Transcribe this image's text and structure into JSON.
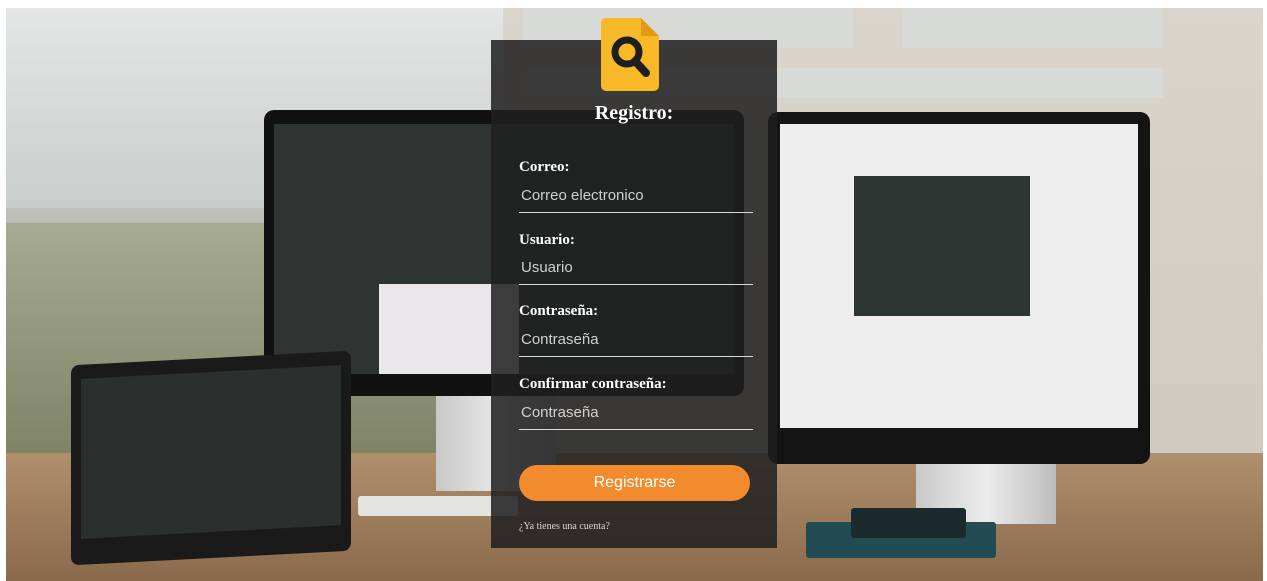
{
  "brand": {
    "logo_icon": "search-document-icon",
    "accent": "#f7b928"
  },
  "form": {
    "title": "Registro:",
    "fields": [
      {
        "label": "Correo:",
        "placeholder": "Correo electronico"
      },
      {
        "label": "Usuario:",
        "placeholder": "Usuario"
      },
      {
        "label": "Contraseña:",
        "placeholder": "Contraseña"
      },
      {
        "label": "Confirmar contraseña:",
        "placeholder": "Contraseña"
      }
    ],
    "submit_label": "Registrarse",
    "login_link": "¿Ya tienes una cuenta?"
  },
  "colors": {
    "button": "#f28b2e",
    "panel": "#202020"
  }
}
